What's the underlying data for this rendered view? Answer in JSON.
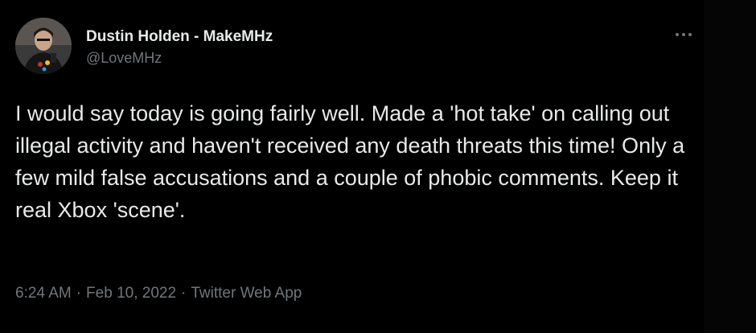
{
  "tweet": {
    "author": {
      "display_name": "Dustin Holden - MakeMHz",
      "handle": "@LoveMHz",
      "avatar_icon": "user-photo-avatar"
    },
    "more_icon": "more-horizontal-icon",
    "text": "I would say today is going fairly well. Made a 'hot take' on calling out illegal activity and haven't received any death threats this time! Only a few mild false accusations and a couple of phobic comments. Keep it real Xbox 'scene'.",
    "time": "6:24 AM",
    "separator": "·",
    "date": "Feb 10, 2022",
    "source": "Twitter Web App"
  },
  "colors": {
    "background": "#000000",
    "primary_text": "#e7e9ea",
    "secondary_text": "#71767b"
  }
}
